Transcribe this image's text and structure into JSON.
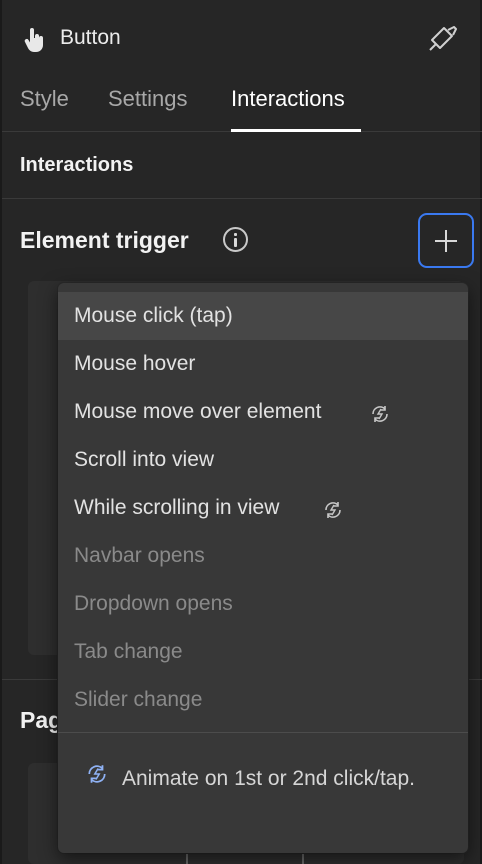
{
  "header": {
    "title": "Button"
  },
  "tabs": [
    {
      "label": "Style"
    },
    {
      "label": "Settings"
    },
    {
      "label": "Interactions"
    }
  ],
  "section": {
    "label": "Interactions"
  },
  "trigger": {
    "label": "Element trigger"
  },
  "page_section": {
    "label": "Pag"
  },
  "menu": {
    "items": [
      {
        "label": "Mouse click (tap)",
        "enabled": true,
        "highlighted": true,
        "ix_icon": false
      },
      {
        "label": "Mouse hover",
        "enabled": true,
        "highlighted": false,
        "ix_icon": false
      },
      {
        "label": "Mouse move over element",
        "enabled": true,
        "highlighted": false,
        "ix_icon": true
      },
      {
        "label": "Scroll into view",
        "enabled": true,
        "highlighted": false,
        "ix_icon": false
      },
      {
        "label": "While scrolling in view",
        "enabled": true,
        "highlighted": false,
        "ix_icon": true
      },
      {
        "label": "Navbar opens",
        "enabled": false,
        "highlighted": false,
        "ix_icon": false
      },
      {
        "label": "Dropdown opens",
        "enabled": false,
        "highlighted": false,
        "ix_icon": false
      },
      {
        "label": "Tab change",
        "enabled": false,
        "highlighted": false,
        "ix_icon": false
      },
      {
        "label": "Slider change",
        "enabled": false,
        "highlighted": false,
        "ix_icon": false
      }
    ],
    "hint": "Animate on 1st or 2nd click/tap."
  },
  "icons": {
    "element_type": "hand-pointer-icon",
    "style_brush": "paint-brush-icon",
    "info": "info-icon",
    "add": "plus-icon",
    "ix2": "ix2-refresh-icon"
  },
  "colors": {
    "panel_bg": "#262626",
    "dropdown_bg": "#383838",
    "highlight_bg": "#474747",
    "accent_blue": "#3a79f0",
    "text_enabled": "#e2e2e2",
    "text_disabled": "#8a8a8a"
  }
}
